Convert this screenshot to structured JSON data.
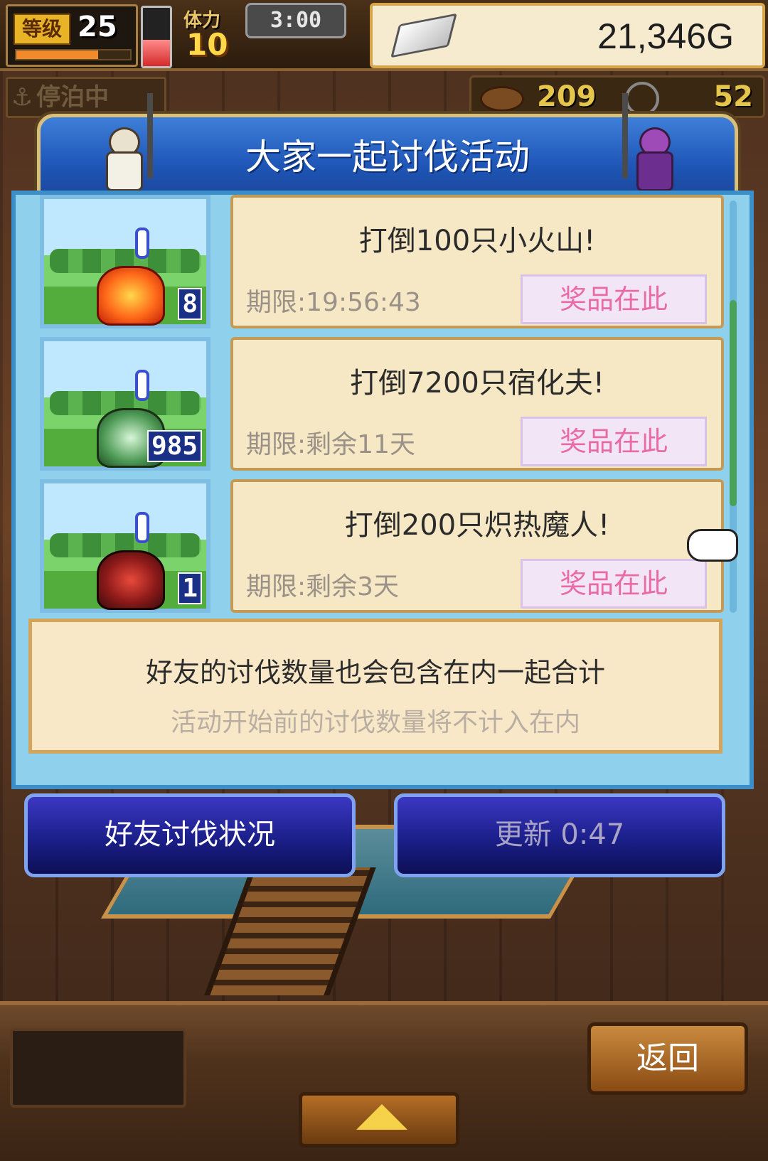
{
  "hud": {
    "level_label": "等级",
    "level": "25",
    "exp_fraction": 0.72,
    "stamina_label": "体力",
    "stamina": "10",
    "stamina_fraction": 0.45,
    "timer": "3:00",
    "gold": "21,346G",
    "status": "停泊中",
    "resource_a": "209",
    "resource_b": "52"
  },
  "dialog": {
    "title": "大家一起讨伐活动",
    "events": [
      {
        "title": "打倒100只小火山!",
        "deadline": "期限:19:56:43",
        "prize_label": "奖品在此",
        "count": "8",
        "monster": "fire"
      },
      {
        "title": "打倒7200只宿化夫!",
        "deadline": "期限:剩余11天",
        "prize_label": "奖品在此",
        "count": "985",
        "monster": "hermit"
      },
      {
        "title": "打倒200只炽热魔人!",
        "deadline": "期限:剩余3天",
        "prize_label": "奖品在此",
        "count": "1",
        "monster": "demon"
      }
    ],
    "info_line1": "好友的讨伐数量也会包含在内一起合计",
    "info_line2": "活动开始前的讨伐数量将不计入在内",
    "friend_button": "好友讨伐状况",
    "refresh_button": "更新 0:47"
  },
  "footer": {
    "back_label": "返回"
  },
  "colors": {
    "dialog_blue": "#1f56b7",
    "prize_pink": "#e86aa7",
    "card_bg": "#f7e8c5"
  }
}
